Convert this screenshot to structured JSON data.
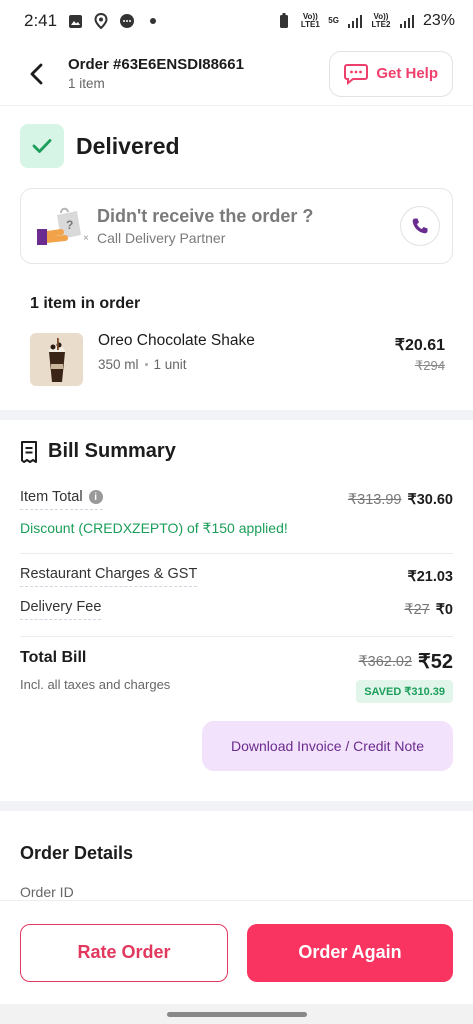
{
  "status_bar": {
    "time": "2:41",
    "battery": "23%",
    "sim1": "Vo)) LTE1",
    "sim2": "Vo)) LTE2",
    "network": "5G"
  },
  "header": {
    "order_number": "Order #63E6ENSDI88661",
    "item_count": "1 item",
    "help_label": "Get Help"
  },
  "status": {
    "title": "Delivered",
    "call_title": "Didn't receive the order ?",
    "call_subtitle": "Call Delivery Partner"
  },
  "items_section": {
    "title": "1 item in order",
    "items": [
      {
        "name": "Oreo Chocolate Shake",
        "size": "350 ml",
        "qty": "1 unit",
        "price": "₹20.61",
        "mrp": "₹294"
      }
    ]
  },
  "bill": {
    "title": "Bill Summary",
    "item_total_label": "Item Total",
    "item_total_old": "₹313.99",
    "item_total_new": "₹30.60",
    "discount_text": "Discount (CREDXZEPTO) of ₹150 applied!",
    "restaurant_label": "Restaurant Charges & GST",
    "restaurant_value": "₹21.03",
    "delivery_label": "Delivery Fee",
    "delivery_old": "₹27",
    "delivery_new": "₹0",
    "total_label": "Total Bill",
    "total_sub": "Incl. all taxes and charges",
    "total_old": "₹362.02",
    "total_new": "₹52",
    "saved": "SAVED ₹310.39",
    "invoice_label": "Download Invoice / Credit Note"
  },
  "order_details": {
    "title": "Order Details",
    "order_id_label": "Order ID"
  },
  "actions": {
    "rate_label": "Rate Order",
    "again_label": "Order Again"
  },
  "colors": {
    "brand_pink": "#fa3461",
    "green": "#1b9e5a",
    "purple": "#6a2c8e"
  }
}
